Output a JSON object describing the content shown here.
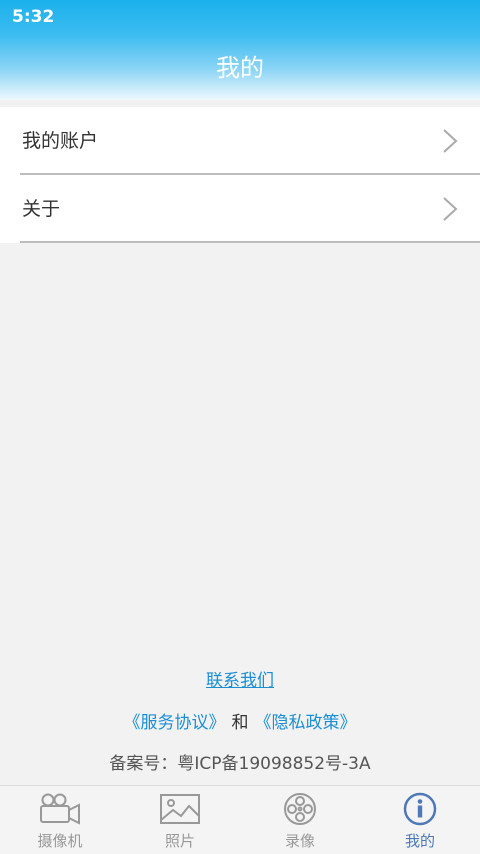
{
  "status_bar": {
    "time": "5:32"
  },
  "header": {
    "title": "我的"
  },
  "menu": {
    "items": [
      {
        "label": "我的账户"
      },
      {
        "label": "关于"
      }
    ]
  },
  "footer": {
    "contact_label": "联系我们",
    "service_agreement": "《服务协议》",
    "and_text": "和",
    "privacy_policy": "《隐私政策》",
    "icp": "备案号：粤ICP备19098852号-3A"
  },
  "tabbar": {
    "tabs": [
      {
        "label": "摄像机",
        "icon": "camera-icon"
      },
      {
        "label": "照片",
        "icon": "photo-icon"
      },
      {
        "label": "录像",
        "icon": "film-reel-icon"
      },
      {
        "label": "我的",
        "icon": "info-icon"
      }
    ],
    "active_index": 3,
    "active_color": "#4e78b8",
    "inactive_color": "#999999"
  },
  "colors": {
    "header_top": "#1bb1ec",
    "link": "#1a8fd6"
  }
}
